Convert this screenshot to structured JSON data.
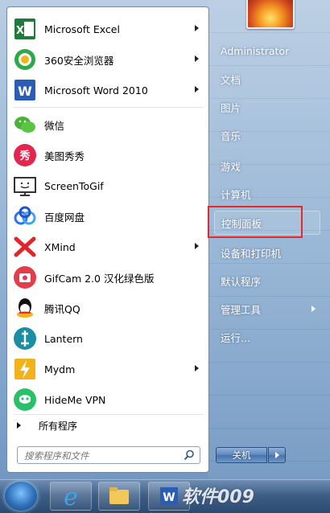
{
  "start_menu": {
    "programs": [
      {
        "label": "Microsoft Excel",
        "icon": "excel-icon",
        "submenu": true
      },
      {
        "label": "360安全浏览器",
        "icon": "360-browser-icon",
        "submenu": true
      },
      {
        "label": "Microsoft Word 2010",
        "icon": "word-icon",
        "submenu": true
      },
      {
        "label": "微信",
        "icon": "wechat-icon",
        "submenu": false
      },
      {
        "label": "美图秀秀",
        "icon": "meitu-icon",
        "submenu": false
      },
      {
        "label": "ScreenToGif",
        "icon": "screentogif-icon",
        "submenu": false
      },
      {
        "label": "百度网盘",
        "icon": "baidu-netdisk-icon",
        "submenu": false
      },
      {
        "label": "XMind",
        "icon": "xmind-icon",
        "submenu": true
      },
      {
        "label": "GifCam 2.0 汉化绿色版",
        "icon": "gifcam-icon",
        "submenu": false
      },
      {
        "label": "腾讯QQ",
        "icon": "qq-icon",
        "submenu": false
      },
      {
        "label": "Lantern",
        "icon": "lantern-icon",
        "submenu": false
      },
      {
        "label": "Mydm",
        "icon": "mydm-icon",
        "submenu": true
      },
      {
        "label": "HideMe VPN",
        "icon": "hideme-vpn-icon",
        "submenu": false
      }
    ],
    "all_programs": "所有程序",
    "search_placeholder": "搜索程序和文件"
  },
  "right_pane": {
    "items": [
      {
        "label": "Administrator",
        "submenu": false
      },
      {
        "label": "文档",
        "submenu": false
      },
      {
        "label": "图片",
        "submenu": false
      },
      {
        "label": "音乐",
        "submenu": false
      },
      {
        "label": "游戏",
        "submenu": false
      },
      {
        "label": "计算机",
        "submenu": false
      },
      {
        "label": "控制面板",
        "submenu": false,
        "highlighted": true
      },
      {
        "label": "设备和打印机",
        "submenu": false
      },
      {
        "label": "默认程序",
        "submenu": false
      },
      {
        "label": "管理工具",
        "submenu": true
      },
      {
        "label": "运行...",
        "submenu": false
      }
    ],
    "shutdown_label": "关机"
  },
  "taskbar": {
    "watermark": "软件009"
  },
  "colors": {
    "highlight_box": "#e62828",
    "menu_bg": "#ffffff"
  }
}
